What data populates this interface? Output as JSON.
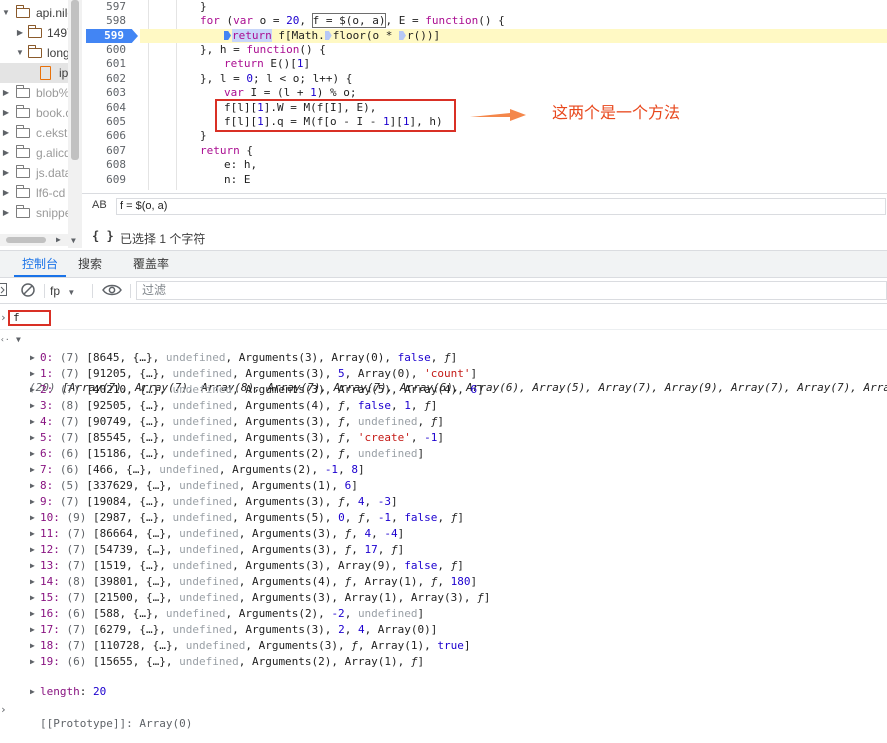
{
  "file_tree": {
    "items": [
      {
        "label": "api.nile",
        "kind": "folder-open",
        "style": "normal"
      },
      {
        "label": "1497",
        "kind": "folder",
        "style": "normal"
      },
      {
        "label": "longs",
        "kind": "folder-open",
        "style": "normal"
      },
      {
        "label": "ip",
        "kind": "file",
        "style": "selected"
      },
      {
        "label": "blob%",
        "kind": "folder",
        "style": "dim"
      },
      {
        "label": "book.c",
        "kind": "folder",
        "style": "dim"
      },
      {
        "label": "c.ekst",
        "kind": "folder",
        "style": "dim"
      },
      {
        "label": "g.alicd",
        "kind": "folder",
        "style": "dim"
      },
      {
        "label": "js.data",
        "kind": "folder",
        "style": "dim"
      },
      {
        "label": "lf6-cd",
        "kind": "folder",
        "style": "dim"
      },
      {
        "label": "snippe",
        "kind": "folder",
        "style": "dim"
      }
    ]
  },
  "editor": {
    "line_numbers": [
      "597",
      "598",
      "599",
      "600",
      "601",
      "602",
      "603",
      "604",
      "605",
      "606",
      "607",
      "608",
      "609"
    ],
    "active_line": "599",
    "lines": {
      "l597": "}",
      "l598_a": "for",
      "l598_b": " (",
      "l598_c": "var",
      "l598_d": " o = ",
      "l598_e": "20",
      "l598_f": ", ",
      "l598_g": "f = $(o, a)",
      "l598_h": ", E = ",
      "l598_i": "function",
      "l598_j": "() {",
      "l599_a": "return",
      "l599_b": " f[Math.",
      "l599_c": "floor(o * ",
      "l599_d": "r())]",
      "l600_a": "}, h = ",
      "l600_b": "function",
      "l600_c": "() {",
      "l601_a": "return",
      "l601_b": " E()[",
      "l601_c": "1",
      "l601_d": "]",
      "l602_a": "}, l = ",
      "l602_b": "0",
      "l602_c": "; l < o; l++) {",
      "l603_a": "var",
      "l603_b": " I = (l + ",
      "l603_c": "1",
      "l603_d": ") % o;",
      "l604_a": "f[l][",
      "l604_b": "1",
      "l604_c": "].W = M(",
      "l604_d": "f[I], E),",
      "l605_a": "f[l][",
      "l605_b": "1",
      "l605_c": "].q = M(",
      "l605_d": "f[o - I - ",
      "l605_e": "1",
      "l605_f": "][",
      "l605_g": "1",
      "l605_h": "], h)",
      "l606": "}",
      "l607_a": "return",
      "l607_b": " {",
      "l608": "e: h,",
      "l609": "n: E"
    }
  },
  "annotation": {
    "text": "这两个是一个方法",
    "color": "#e8471c"
  },
  "expression_bar": {
    "icon": "AB",
    "value": "f = $(o, a)"
  },
  "status_bar": {
    "braces": "{ }",
    "text": "已选择 1 个字符"
  },
  "drawer": {
    "tabs": [
      {
        "label": "控制台",
        "active": true
      },
      {
        "label": "搜索",
        "active": false
      },
      {
        "label": "覆盖率",
        "active": false
      }
    ]
  },
  "console_toolbar": {
    "context": "fp",
    "filter_placeholder": "过滤"
  },
  "console": {
    "prompt_input": "f",
    "summary_count": "(20)",
    "summary_text": "[Array(7), Array(7), Array(8), Array(7), Array(7), Array(6), Array(6), Array(5), Array(7), Array(9), Array(7), Array(7), Arra",
    "entries": [
      {
        "idx": "0:",
        "cnt": "(7)",
        "parts": [
          [
            "txt",
            "[8645, {…}, "
          ],
          [
            "undef",
            "undefined"
          ],
          [
            "txt",
            ", Arguments(3), Array(0), "
          ],
          [
            "nm",
            "false"
          ],
          [
            "txt",
            ", "
          ],
          [
            "fn",
            "ƒ"
          ],
          [
            "txt",
            "]"
          ]
        ]
      },
      {
        "idx": "1:",
        "cnt": "(7)",
        "parts": [
          [
            "txt",
            "[91205, {…}, "
          ],
          [
            "undef",
            "undefined"
          ],
          [
            "txt",
            ", Arguments(3), "
          ],
          [
            "nm",
            "5"
          ],
          [
            "txt",
            ", Array(0), "
          ],
          [
            "str",
            "'count'"
          ],
          [
            "txt",
            "]"
          ]
        ]
      },
      {
        "idx": "2:",
        "cnt": "(7)",
        "parts": [
          [
            "txt",
            "[40210, {…}, "
          ],
          [
            "undef",
            "undefined"
          ],
          [
            "txt",
            ", Arguments(3), Array(5), Array(4), "
          ],
          [
            "nm",
            "6"
          ],
          [
            "txt",
            "]"
          ]
        ]
      },
      {
        "idx": "3:",
        "cnt": "(8)",
        "parts": [
          [
            "txt",
            "[92505, {…}, "
          ],
          [
            "undef",
            "undefined"
          ],
          [
            "txt",
            ", Arguments(4), "
          ],
          [
            "fn",
            "ƒ"
          ],
          [
            "txt",
            ", "
          ],
          [
            "nm",
            "false"
          ],
          [
            "txt",
            ", "
          ],
          [
            "nm",
            "1"
          ],
          [
            "txt",
            ", "
          ],
          [
            "fn",
            "ƒ"
          ],
          [
            "txt",
            "]"
          ]
        ]
      },
      {
        "idx": "4:",
        "cnt": "(7)",
        "parts": [
          [
            "txt",
            "[90749, {…}, "
          ],
          [
            "undef",
            "undefined"
          ],
          [
            "txt",
            ", Arguments(3), "
          ],
          [
            "fn",
            "ƒ"
          ],
          [
            "txt",
            ", "
          ],
          [
            "undef",
            "undefined"
          ],
          [
            "txt",
            ", "
          ],
          [
            "fn",
            "ƒ"
          ],
          [
            "txt",
            "]"
          ]
        ]
      },
      {
        "idx": "5:",
        "cnt": "(7)",
        "parts": [
          [
            "txt",
            "[85545, {…}, "
          ],
          [
            "undef",
            "undefined"
          ],
          [
            "txt",
            ", Arguments(3), "
          ],
          [
            "fn",
            "ƒ"
          ],
          [
            "txt",
            ", "
          ],
          [
            "str",
            "'create'"
          ],
          [
            "txt",
            ", "
          ],
          [
            "nm",
            "-1"
          ],
          [
            "txt",
            "]"
          ]
        ]
      },
      {
        "idx": "6:",
        "cnt": "(6)",
        "parts": [
          [
            "txt",
            "[15186, {…}, "
          ],
          [
            "undef",
            "undefined"
          ],
          [
            "txt",
            ", Arguments(2), "
          ],
          [
            "fn",
            "ƒ"
          ],
          [
            "txt",
            ", "
          ],
          [
            "undef",
            "undefined"
          ],
          [
            "txt",
            "]"
          ]
        ]
      },
      {
        "idx": "7:",
        "cnt": "(6)",
        "parts": [
          [
            "txt",
            "[466, {…}, "
          ],
          [
            "undef",
            "undefined"
          ],
          [
            "txt",
            ", Arguments(2), "
          ],
          [
            "nm",
            "-1"
          ],
          [
            "txt",
            ", "
          ],
          [
            "nm",
            "8"
          ],
          [
            "txt",
            "]"
          ]
        ]
      },
      {
        "idx": "8:",
        "cnt": "(5)",
        "parts": [
          [
            "txt",
            "[337629, {…}, "
          ],
          [
            "undef",
            "undefined"
          ],
          [
            "txt",
            ", Arguments(1), "
          ],
          [
            "nm",
            "6"
          ],
          [
            "txt",
            "]"
          ]
        ]
      },
      {
        "idx": "9:",
        "cnt": "(7)",
        "parts": [
          [
            "txt",
            "[19084, {…}, "
          ],
          [
            "undef",
            "undefined"
          ],
          [
            "txt",
            ", Arguments(3), "
          ],
          [
            "fn",
            "ƒ"
          ],
          [
            "txt",
            ", "
          ],
          [
            "nm",
            "4"
          ],
          [
            "txt",
            ", "
          ],
          [
            "nm",
            "-3"
          ],
          [
            "txt",
            "]"
          ]
        ]
      },
      {
        "idx": "10:",
        "cnt": "(9)",
        "parts": [
          [
            "txt",
            "[2987, {…}, "
          ],
          [
            "undef",
            "undefined"
          ],
          [
            "txt",
            ", Arguments(5), "
          ],
          [
            "nm",
            "0"
          ],
          [
            "txt",
            ", "
          ],
          [
            "fn",
            "ƒ"
          ],
          [
            "txt",
            ", "
          ],
          [
            "nm",
            "-1"
          ],
          [
            "txt",
            ", "
          ],
          [
            "nm",
            "false"
          ],
          [
            "txt",
            ", "
          ],
          [
            "fn",
            "ƒ"
          ],
          [
            "txt",
            "]"
          ]
        ]
      },
      {
        "idx": "11:",
        "cnt": "(7)",
        "parts": [
          [
            "txt",
            "[86664, {…}, "
          ],
          [
            "undef",
            "undefined"
          ],
          [
            "txt",
            ", Arguments(3), "
          ],
          [
            "fn",
            "ƒ"
          ],
          [
            "txt",
            ", "
          ],
          [
            "nm",
            "4"
          ],
          [
            "txt",
            ", "
          ],
          [
            "nm",
            "-4"
          ],
          [
            "txt",
            "]"
          ]
        ]
      },
      {
        "idx": "12:",
        "cnt": "(7)",
        "parts": [
          [
            "txt",
            "[54739, {…}, "
          ],
          [
            "undef",
            "undefined"
          ],
          [
            "txt",
            ", Arguments(3), "
          ],
          [
            "fn",
            "ƒ"
          ],
          [
            "txt",
            ", "
          ],
          [
            "nm",
            "17"
          ],
          [
            "txt",
            ", "
          ],
          [
            "fn",
            "ƒ"
          ],
          [
            "txt",
            "]"
          ]
        ]
      },
      {
        "idx": "13:",
        "cnt": "(7)",
        "parts": [
          [
            "txt",
            "[1519, {…}, "
          ],
          [
            "undef",
            "undefined"
          ],
          [
            "txt",
            ", Arguments(3), Array(9), "
          ],
          [
            "nm",
            "false"
          ],
          [
            "txt",
            ", "
          ],
          [
            "fn",
            "ƒ"
          ],
          [
            "txt",
            "]"
          ]
        ]
      },
      {
        "idx": "14:",
        "cnt": "(8)",
        "parts": [
          [
            "txt",
            "[39801, {…}, "
          ],
          [
            "undef",
            "undefined"
          ],
          [
            "txt",
            ", Arguments(4), "
          ],
          [
            "fn",
            "ƒ"
          ],
          [
            "txt",
            ", Array(1), "
          ],
          [
            "fn",
            "ƒ"
          ],
          [
            "txt",
            ", "
          ],
          [
            "nm",
            "180"
          ],
          [
            "txt",
            "]"
          ]
        ]
      },
      {
        "idx": "15:",
        "cnt": "(7)",
        "parts": [
          [
            "txt",
            "[21500, {…}, "
          ],
          [
            "undef",
            "undefined"
          ],
          [
            "txt",
            ", Arguments(3), Array(1), Array(3), "
          ],
          [
            "fn",
            "ƒ"
          ],
          [
            "txt",
            "]"
          ]
        ]
      },
      {
        "idx": "16:",
        "cnt": "(6)",
        "parts": [
          [
            "txt",
            "[588, {…}, "
          ],
          [
            "undef",
            "undefined"
          ],
          [
            "txt",
            ", Arguments(2), "
          ],
          [
            "nm",
            "-2"
          ],
          [
            "txt",
            ", "
          ],
          [
            "undef",
            "undefined"
          ],
          [
            "txt",
            "]"
          ]
        ]
      },
      {
        "idx": "17:",
        "cnt": "(7)",
        "parts": [
          [
            "txt",
            "[6279, {…}, "
          ],
          [
            "undef",
            "undefined"
          ],
          [
            "txt",
            ", Arguments(3), "
          ],
          [
            "nm",
            "2"
          ],
          [
            "txt",
            ", "
          ],
          [
            "nm",
            "4"
          ],
          [
            "txt",
            ", Array(0)]"
          ]
        ]
      },
      {
        "idx": "18:",
        "cnt": "(7)",
        "parts": [
          [
            "txt",
            "[110728, {…}, "
          ],
          [
            "undef",
            "undefined"
          ],
          [
            "txt",
            ", Arguments(3), "
          ],
          [
            "fn",
            "ƒ"
          ],
          [
            "txt",
            ", Array(1), "
          ],
          [
            "nm",
            "true"
          ],
          [
            "txt",
            "]"
          ]
        ]
      },
      {
        "idx": "19:",
        "cnt": "(6)",
        "parts": [
          [
            "txt",
            "[15655, {…}, "
          ],
          [
            "undef",
            "undefined"
          ],
          [
            "txt",
            ", Arguments(2), Array(1), "
          ],
          [
            "fn",
            "ƒ"
          ],
          [
            "txt",
            "]"
          ]
        ]
      }
    ],
    "length_key": "length",
    "length_value": "20",
    "prototype_text": "[[Prototype]]: Array(0)"
  }
}
